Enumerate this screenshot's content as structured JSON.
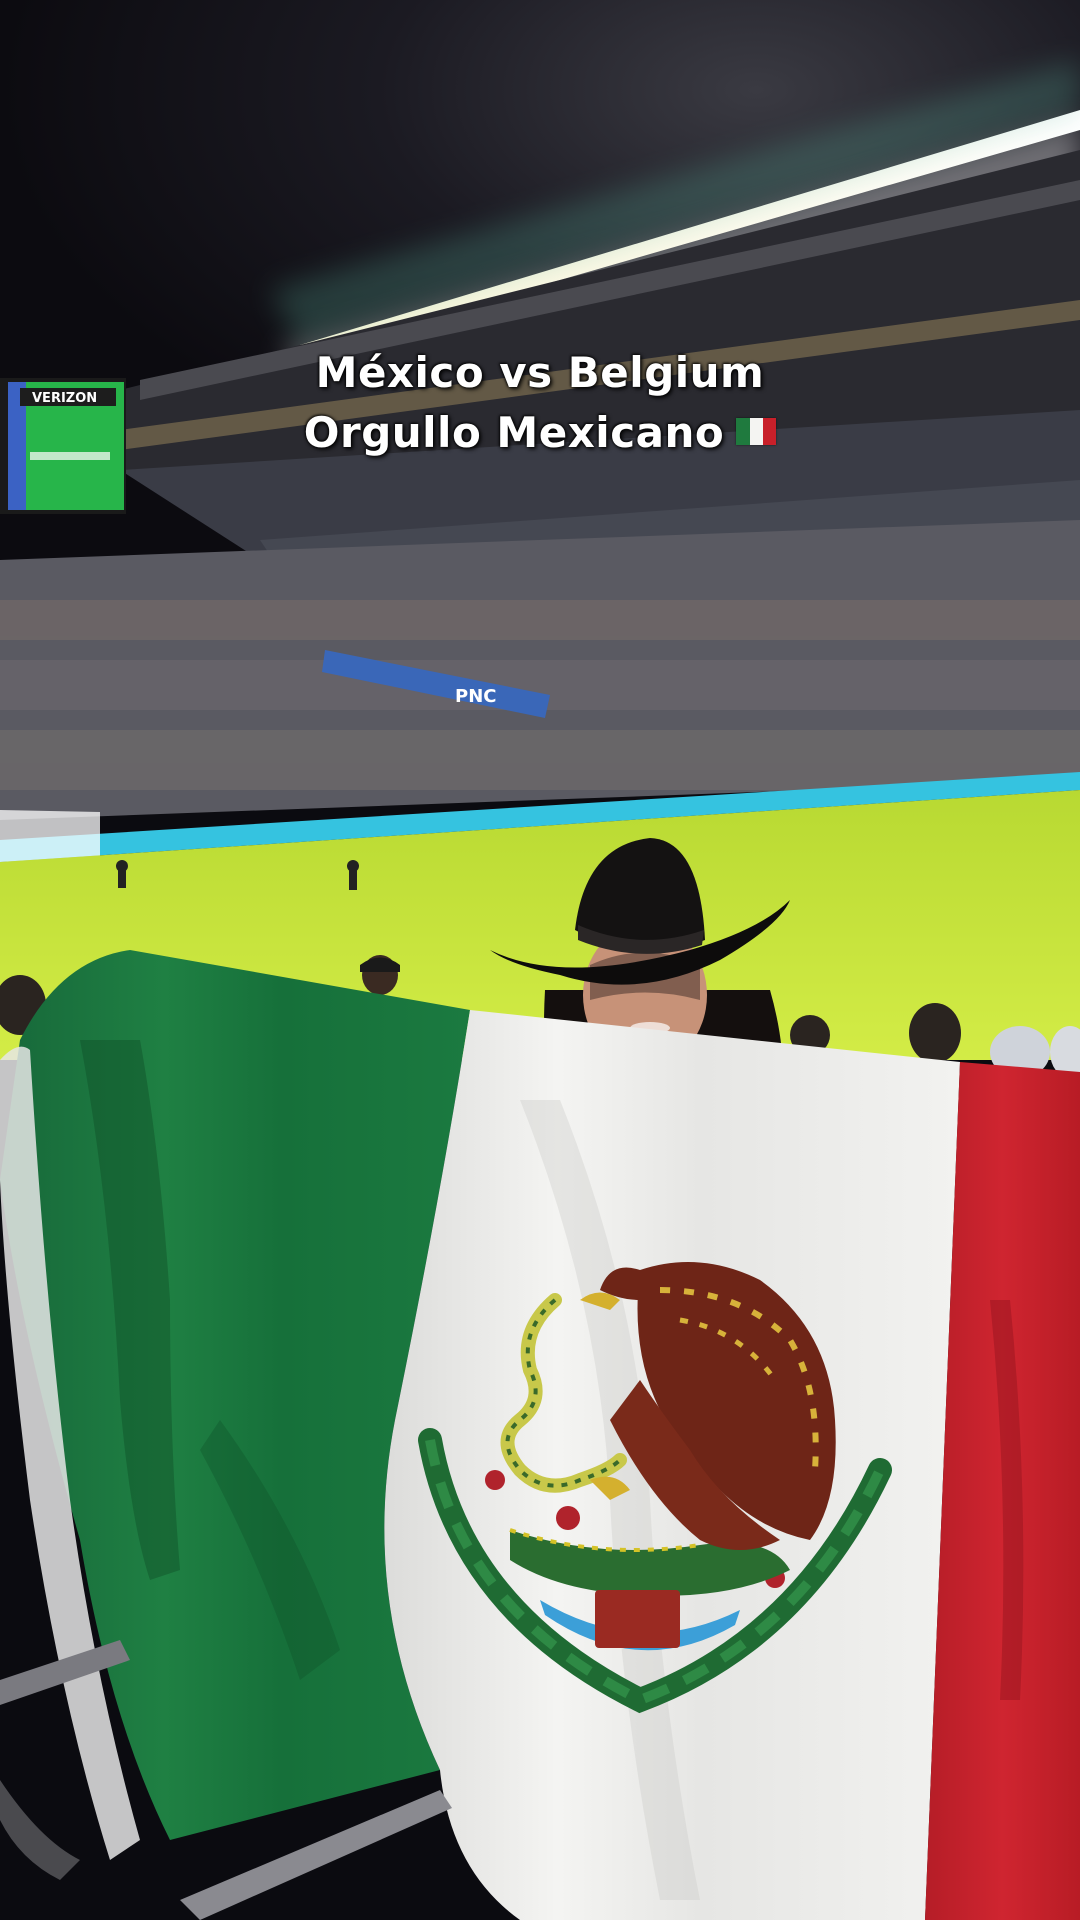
{
  "caption": {
    "line1": "México vs Belgium",
    "line2": "Orgullo Mexicano",
    "line2_emoji": "mexico-flag-emoji"
  },
  "scoreboard": {
    "brand": "VERIZON"
  },
  "sponsor_banner": {
    "text": "PNC"
  },
  "colors": {
    "flag_green": "#1f7a3e",
    "flag_white": "#f2f2f0",
    "flag_red": "#c8202a",
    "pitch": "#c9e53a",
    "sky": "#121018",
    "led_board": "#3fd0e8"
  }
}
